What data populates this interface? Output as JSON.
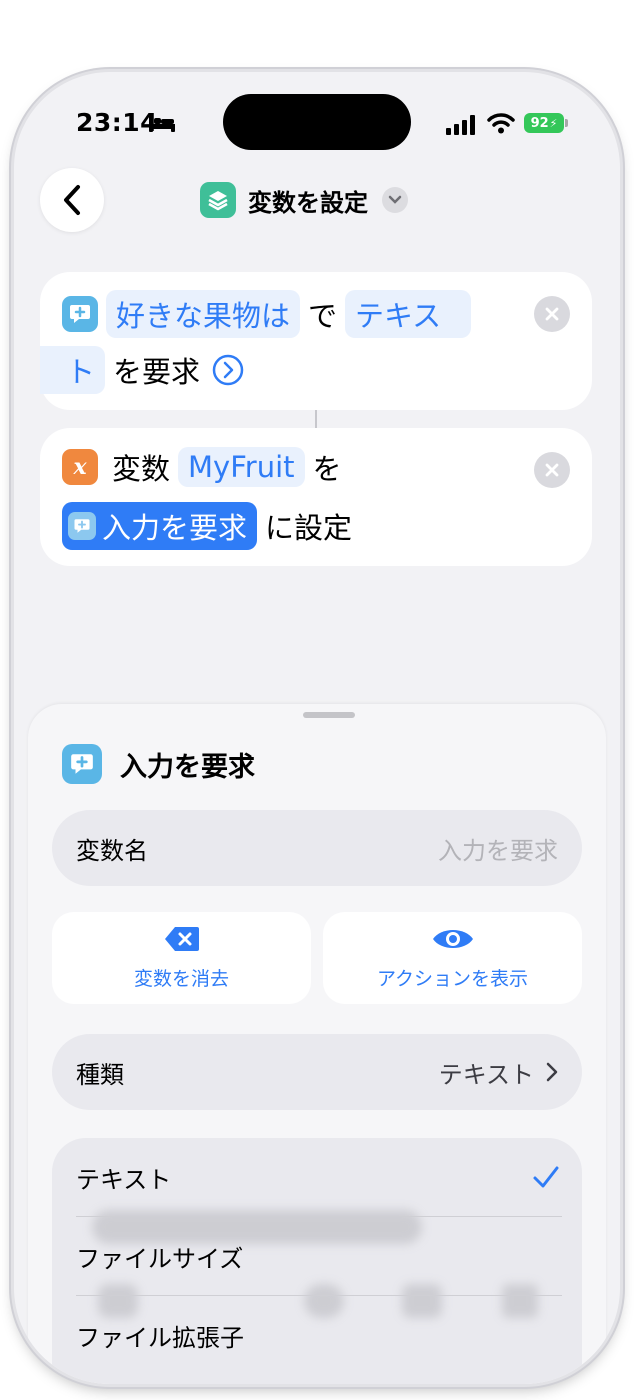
{
  "status": {
    "time": "23:14",
    "battery": "92"
  },
  "nav": {
    "title": "変数を設定"
  },
  "action1": {
    "prompt": "好きな果物は",
    "de": "で",
    "type_part1": "テキス",
    "type_part2": "ト",
    "suffix": "を要求"
  },
  "action2": {
    "label": "変数",
    "var_name": "MyFruit",
    "wo": "を",
    "input_token": "入力を要求",
    "suffix": "に設定"
  },
  "sheet": {
    "title": "入力を要求",
    "var_name_label": "変数名",
    "var_name_placeholder": "入力を要求",
    "clear_label": "変数を消去",
    "show_action_label": "アクションを表示",
    "type_label": "種類",
    "type_value": "テキスト",
    "options": [
      "テキスト",
      "ファイルサイズ",
      "ファイル拡張子"
    ],
    "selected_index": 0
  },
  "colors": {
    "accent": "#2f7cf6",
    "shortcut_app": "#3fbf98",
    "variable": "#f0883e",
    "ask_input": "#5ab6e6"
  }
}
